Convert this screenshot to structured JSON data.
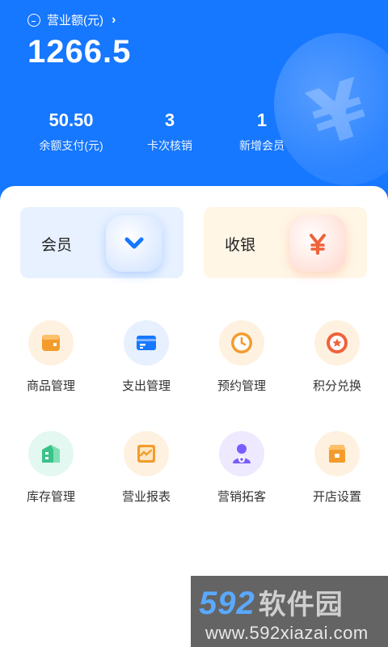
{
  "header": {
    "revenue_label": "营业额(元)",
    "revenue_value": "1266.5",
    "stats": [
      {
        "value": "50.50",
        "label": "余额支付(元)"
      },
      {
        "value": "3",
        "label": "卡次核销"
      },
      {
        "value": "1",
        "label": "新增会员"
      }
    ]
  },
  "cards": {
    "member": {
      "label": "会员"
    },
    "cashier": {
      "label": "收银"
    }
  },
  "grid": [
    {
      "label": "商品管理",
      "icon": "product-box-icon"
    },
    {
      "label": "支出管理",
      "icon": "expense-card-icon"
    },
    {
      "label": "预约管理",
      "icon": "clock-icon"
    },
    {
      "label": "积分兑换",
      "icon": "star-medal-icon"
    },
    {
      "label": "库存管理",
      "icon": "warehouse-icon"
    },
    {
      "label": "营业报表",
      "icon": "report-chart-icon"
    },
    {
      "label": "营销拓客",
      "icon": "user-add-icon"
    },
    {
      "label": "开店设置",
      "icon": "store-icon"
    }
  ],
  "watermark": {
    "brand": "592",
    "brand_cn": "软件园",
    "url": "www.592xiazai.com"
  },
  "colors": {
    "primary": "#1677ff",
    "orange": "#f39c2c",
    "red_orange": "#f0623a",
    "green": "#3ac28a",
    "purple": "#7b5cff"
  }
}
